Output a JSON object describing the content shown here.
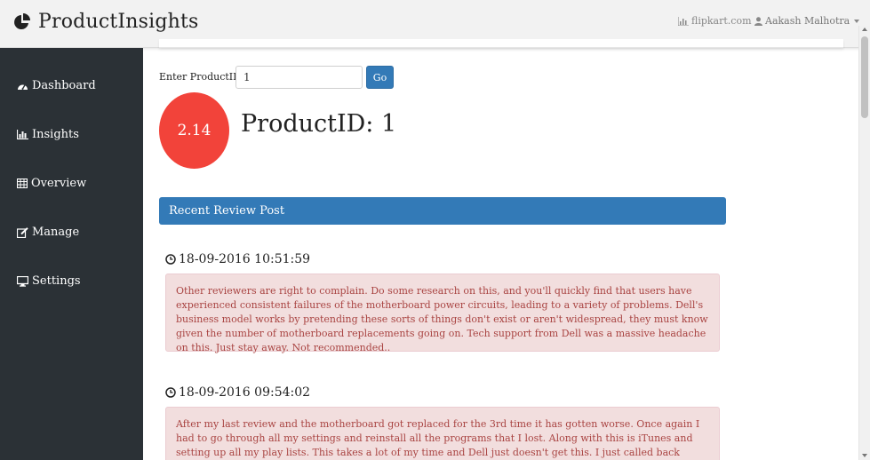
{
  "brand": {
    "title": "ProductInsights"
  },
  "navbar": {
    "site_link": "flipkart.com",
    "user_name": "Aakash Malhotra"
  },
  "sidebar": {
    "items": [
      {
        "label": "Dashboard",
        "icon": "dashboard-icon"
      },
      {
        "label": "Insights",
        "icon": "bar-chart-icon"
      },
      {
        "label": "Overview",
        "icon": "table-icon"
      },
      {
        "label": "Manage",
        "icon": "edit-icon"
      },
      {
        "label": "Settings",
        "icon": "desktop-icon"
      }
    ]
  },
  "form": {
    "label": "Enter ProductID:",
    "value": "1",
    "go_label": "Go"
  },
  "product": {
    "score": "2.14",
    "heading": "ProductID: 1"
  },
  "panel": {
    "title": "Recent Review Post"
  },
  "reviews": [
    {
      "timestamp": "18-09-2016 10:51:59",
      "text": "Other reviewers are right to complain. Do some research on this, and you'll quickly find that users have experienced consistent failures of the motherboard power circuits, leading to a variety of problems. Dell's business model works by pretending these sorts of things don't exist or aren't widespread, they must know given the number of motherboard replacements going on. Tech support from Dell was a massive headache on this. Just stay away. Not recommended.."
    },
    {
      "timestamp": "18-09-2016 09:54:02",
      "text": "After my last review and the motherboard got replaced for the 3rd time it has gotten worse. Once again I had to go through all my settings and reinstall all the programs that I lost. Along with this is iTunes and setting up all my play lists. This takes a lot of my time and Dell just doesn't get this. I just called back because the last tech messed up the built in microphone and"
    }
  ],
  "colors": {
    "primary": "#337ab7",
    "score_badge": "#f2433a",
    "sidebar_bg": "#2b3136",
    "alert_bg": "#f2dede",
    "alert_text": "#a94442"
  }
}
